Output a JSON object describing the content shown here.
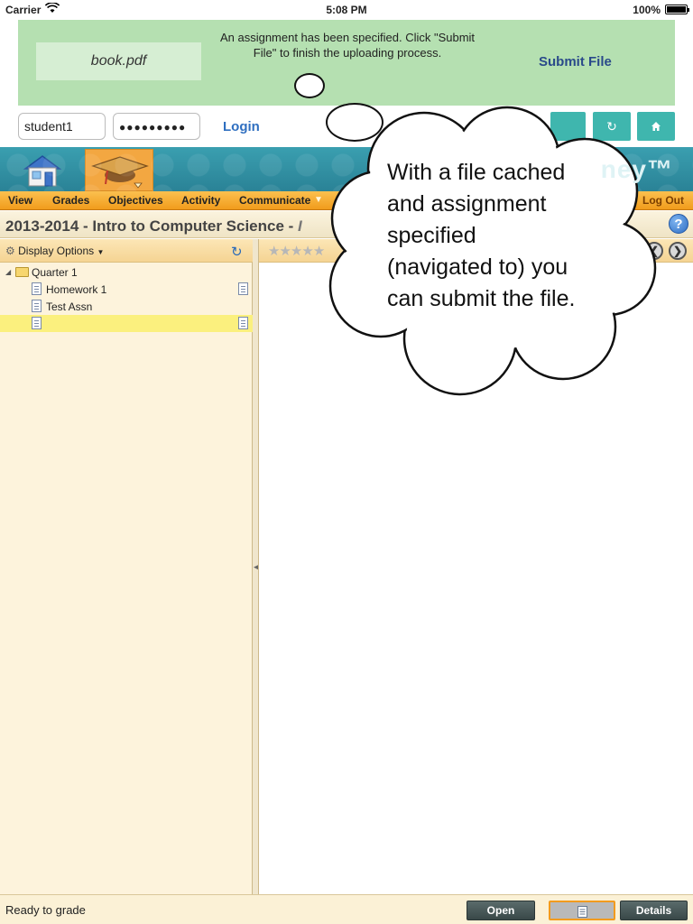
{
  "status_bar": {
    "carrier": "Carrier",
    "time": "5:08 PM",
    "battery": "100%"
  },
  "upload_banner": {
    "file_name": "book.pdf",
    "message": "An assignment has been specified. Click \"Submit File\" to finish the uploading process.",
    "submit_label": "Submit File"
  },
  "login": {
    "username_value": "student1",
    "password_value": "●●●●●●●●●",
    "login_label": "Login"
  },
  "header": {
    "brand_fragment": "ney™"
  },
  "menu": {
    "items": [
      "View",
      "Grades",
      "Objectives",
      "Activity",
      "Communicate"
    ],
    "logout_label": "Log Out"
  },
  "course": {
    "title": "2013-2014 - Intro to Computer Science - ",
    "title_italic": "I"
  },
  "left_panel": {
    "display_options_label": "Display Options",
    "tree": {
      "folder": "Quarter 1",
      "items": [
        {
          "label": "Homework 1"
        },
        {
          "label": "Test Assn"
        },
        {
          "label": ""
        }
      ]
    }
  },
  "footer": {
    "status": "Ready to grade",
    "open_label": "Open",
    "details_label": "Details"
  },
  "callout": {
    "line1": "With a file cached",
    "line2": "and assignment",
    "line3": "specified",
    "line4": "(navigated to) you",
    "line5": "can submit the file."
  },
  "colors": {
    "banner_bg": "#b5e0b1",
    "teal_button": "#3fb6ae",
    "menu_orange": "#f19c1c",
    "selected_row": "#fbf07e",
    "link_blue": "#2f6fc0"
  }
}
